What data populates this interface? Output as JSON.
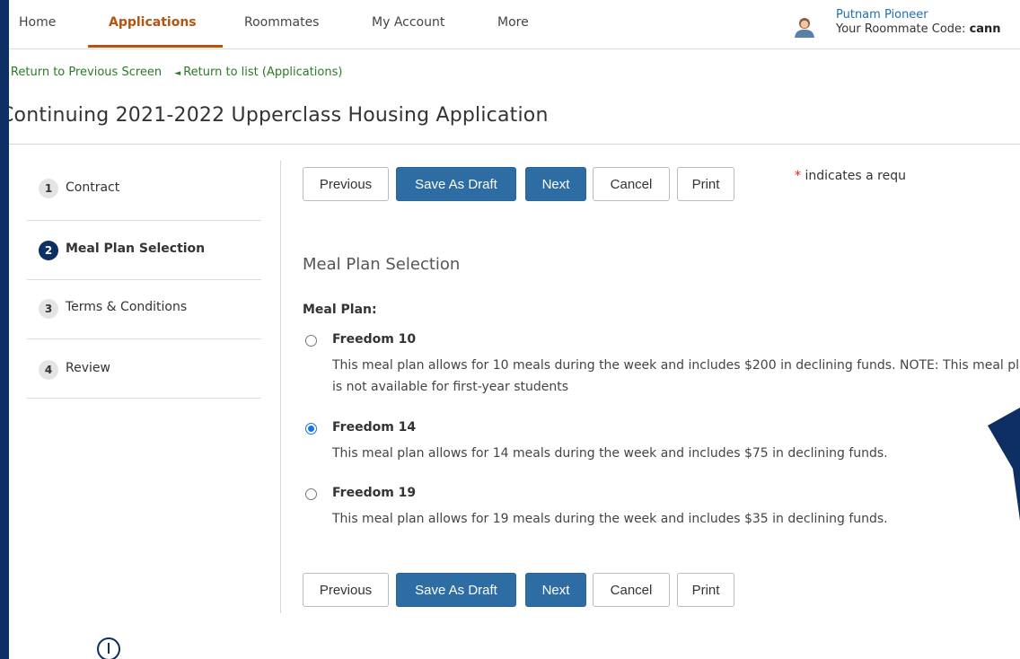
{
  "nav": {
    "items": [
      "Home",
      "Applications",
      "Roommates",
      "My Account",
      "More"
    ],
    "active": "Applications"
  },
  "user": {
    "name": "Putnam Pioneer",
    "code_label": "Your Roommate Code:",
    "code_value": "cann"
  },
  "breadcrumbs": [
    "Return to Previous Screen",
    "Return to list (Applications)"
  ],
  "page_title": "Continuing 2021-2022 Upperclass Housing Application",
  "steps": [
    {
      "num": "1",
      "label": "Contract"
    },
    {
      "num": "2",
      "label": "Meal Plan Selection",
      "current": true
    },
    {
      "num": "3",
      "label": "Terms & Conditions"
    },
    {
      "num": "4",
      "label": "Review"
    }
  ],
  "buttons": {
    "previous": "Previous",
    "save_draft": "Save As Draft",
    "next": "Next",
    "cancel": "Cancel",
    "print": "Print"
  },
  "required_note": {
    "star": "*",
    "text": "indicates a requ"
  },
  "section_title": "Meal Plan Selection",
  "field_label": "Meal Plan:",
  "options": [
    {
      "name": "Freedom 10",
      "desc": "This meal plan allows for 10 meals during the week and includes $200 in declining funds. NOTE: This meal plan is not available for first-year students",
      "selected": false
    },
    {
      "name": "Freedom 14",
      "desc": "This meal plan allows for 14 meals during the week and includes $75 in declining funds.",
      "selected": true
    },
    {
      "name": "Freedom 19",
      "desc": "This meal plan allows for 19 meals during the week and includes $35 in declining funds.",
      "selected": false
    }
  ],
  "colors": {
    "brand_dark": "#0d2f63",
    "nav_active": "#b8530f",
    "primary_button": "#2e6da4",
    "link_green": "#2a7a2a"
  }
}
